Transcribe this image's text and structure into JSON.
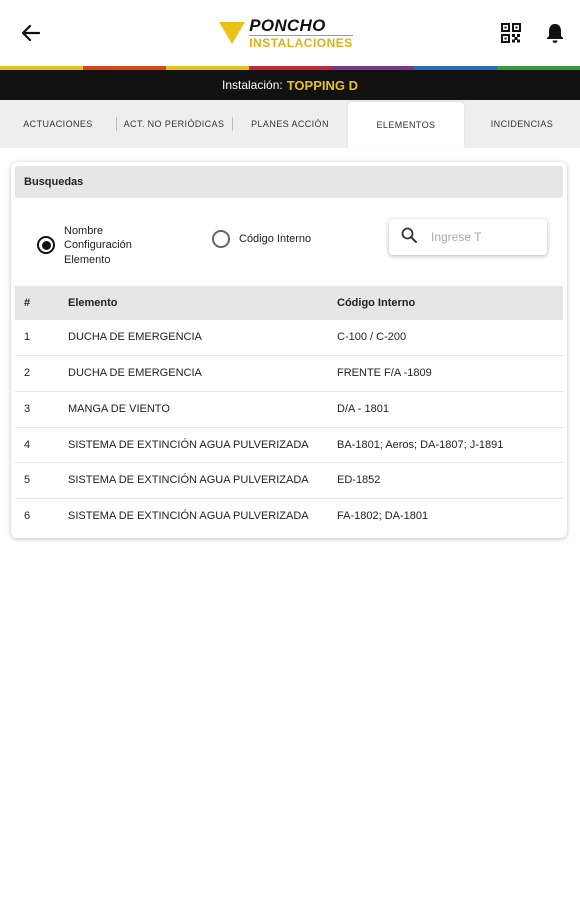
{
  "header": {
    "back_icon": "arrow-left-icon",
    "logo_top": "PONCHO",
    "logo_bottom": "INSTALACIONES",
    "qr_icon": "qr-code-icon",
    "bell_icon": "bell-icon"
  },
  "stripe_colors": [
    "#e8c21a",
    "#d9461b",
    "#e8c21a",
    "#c02a3a",
    "#7a3a8a",
    "#2a6ab4",
    "#3a9a3a"
  ],
  "installation": {
    "label": "Instalación:",
    "value": "TOPPING D"
  },
  "tabs": [
    {
      "label": "ACTUACIONES"
    },
    {
      "label": "ACT. NO PERIÓDICAS"
    },
    {
      "label": "PLANES ACCIÓN"
    },
    {
      "label": "ELEMENTOS"
    },
    {
      "label": "INCIDENCIAS"
    }
  ],
  "search": {
    "section_title": "Busquedas",
    "option1_label": "Nombre\nConfiguración\nElemento",
    "option2_label": "Código Interno",
    "placeholder": "Ingrese T"
  },
  "table": {
    "headers": [
      "#",
      "Elemento",
      "Código Interno"
    ],
    "rows": [
      {
        "num": "1",
        "elemento": "DUCHA DE EMERGENCIA",
        "codigo": "C-100 / C-200"
      },
      {
        "num": "2",
        "elemento": "DUCHA DE EMERGENCIA",
        "codigo": "FRENTE F/A -1809"
      },
      {
        "num": "3",
        "elemento": "MANGA DE VIENTO",
        "codigo": "D/A - 1801"
      },
      {
        "num": "4",
        "elemento": "SISTEMA DE EXTINCIÓN AGUA PULVERIZADA",
        "codigo": "BA-1801; Aeros; DA-1807; J-1891"
      },
      {
        "num": "5",
        "elemento": "SISTEMA DE EXTINCIÓN AGUA PULVERIZADA",
        "codigo": "ED-1852"
      },
      {
        "num": "6",
        "elemento": "SISTEMA DE EXTINCIÓN AGUA PULVERIZADA",
        "codigo": "FA-1802; DA-1801"
      }
    ]
  }
}
